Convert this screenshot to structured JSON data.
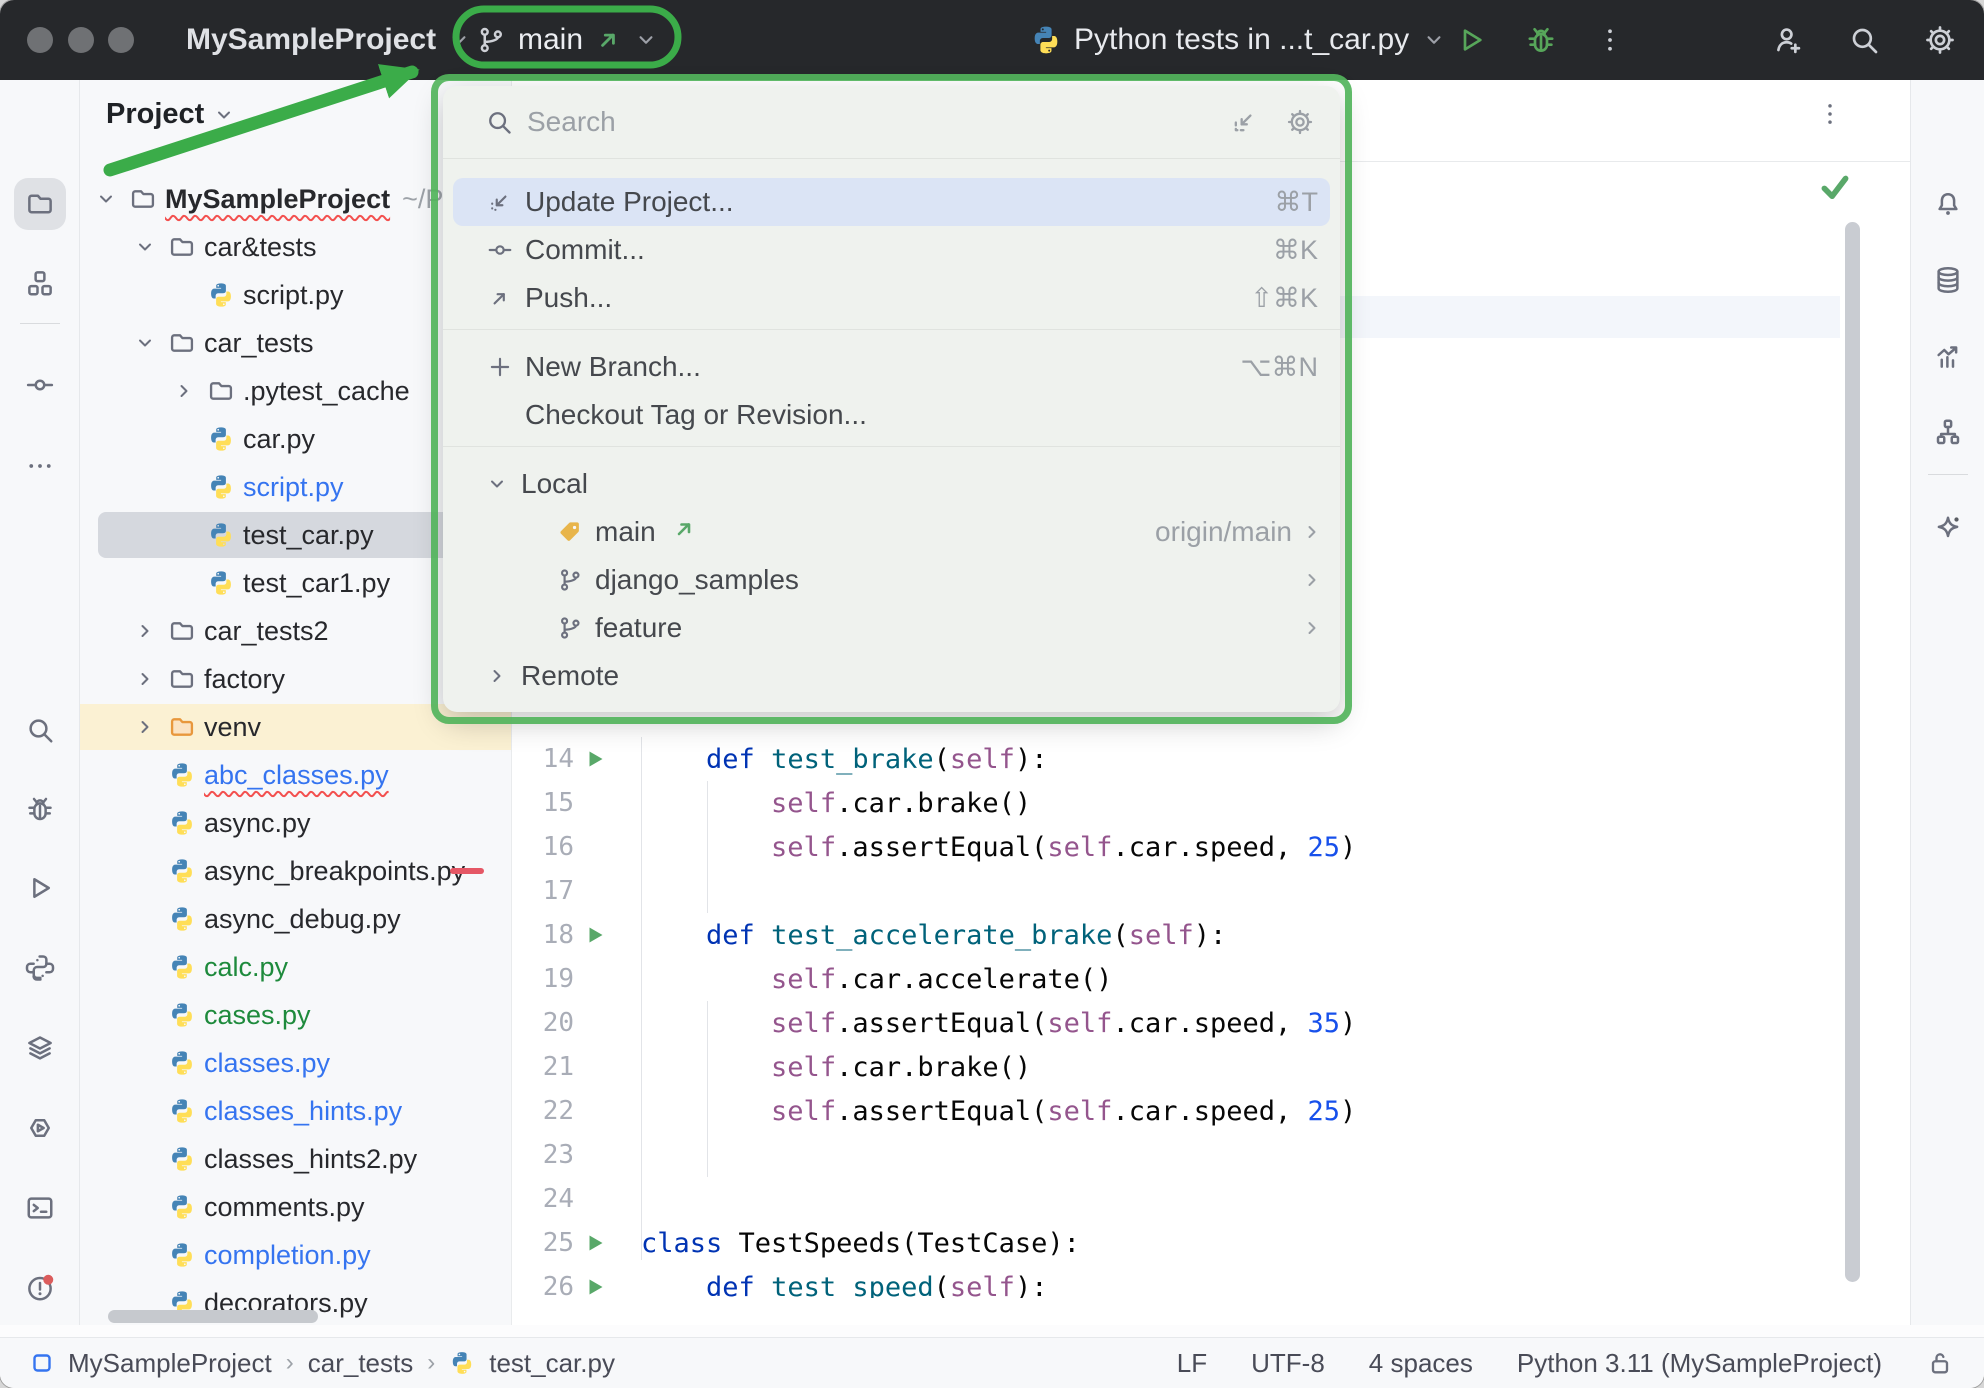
{
  "titlebar": {
    "project_name": "MySampleProject",
    "branch_name": "main",
    "run_config": "Python tests in ...t_car.py"
  },
  "left_toolbar": {
    "icons": [
      "folder",
      "structure",
      "commit",
      "more",
      "search",
      "bug",
      "play",
      "python-mono",
      "layers",
      "services",
      "terminal",
      "problems",
      "git-branch"
    ]
  },
  "right_toolbar": {
    "icons": [
      "bell",
      "database",
      "chart",
      "hierarchy",
      "sparkle"
    ]
  },
  "project_panel": {
    "header": "Project",
    "rows": [
      {
        "depth": 0,
        "chev": "open",
        "icon": "folder",
        "label": "MySampleProject",
        "bold": true,
        "squiggle": true,
        "suffix": "~/P"
      },
      {
        "depth": 1,
        "chev": "open",
        "icon": "folder",
        "label": "car&tests"
      },
      {
        "depth": 2,
        "chev": "none",
        "icon": "python",
        "label": "script.py"
      },
      {
        "depth": 1,
        "chev": "open",
        "icon": "folder",
        "label": "car_tests"
      },
      {
        "depth": 2,
        "chev": "closed",
        "icon": "folder",
        "label": ".pytest_cache"
      },
      {
        "depth": 2,
        "chev": "none",
        "icon": "python",
        "label": "car.py"
      },
      {
        "depth": 2,
        "chev": "none",
        "icon": "python",
        "label": "script.py",
        "color": "blue"
      },
      {
        "depth": 2,
        "chev": "none",
        "icon": "python",
        "label": "test_car.py",
        "selected": true
      },
      {
        "depth": 2,
        "chev": "none",
        "icon": "python",
        "label": "test_car1.py"
      },
      {
        "depth": 1,
        "chev": "closed",
        "icon": "folder",
        "label": "car_tests2"
      },
      {
        "depth": 1,
        "chev": "closed",
        "icon": "folder",
        "label": "factory"
      },
      {
        "depth": 1,
        "chev": "closed",
        "icon": "folder-venv",
        "label": "venv",
        "rowbg": "#FBF1D3"
      },
      {
        "depth": 1,
        "chev": "none",
        "icon": "python",
        "label": "abc_classes.py",
        "color": "blue",
        "squiggle": true
      },
      {
        "depth": 1,
        "chev": "none",
        "icon": "python",
        "label": "async.py"
      },
      {
        "depth": 1,
        "chev": "none",
        "icon": "python",
        "label": "async_breakpoints.py",
        "reddash": true
      },
      {
        "depth": 1,
        "chev": "none",
        "icon": "python",
        "label": "async_debug.py"
      },
      {
        "depth": 1,
        "chev": "none",
        "icon": "python",
        "label": "calc.py",
        "color": "green"
      },
      {
        "depth": 1,
        "chev": "none",
        "icon": "python",
        "label": "cases.py",
        "color": "green"
      },
      {
        "depth": 1,
        "chev": "none",
        "icon": "python",
        "label": "classes.py",
        "color": "blue"
      },
      {
        "depth": 1,
        "chev": "none",
        "icon": "python",
        "label": "classes_hints.py",
        "color": "blue"
      },
      {
        "depth": 1,
        "chev": "none",
        "icon": "python",
        "label": "classes_hints2.py"
      },
      {
        "depth": 1,
        "chev": "none",
        "icon": "python",
        "label": "comments.py"
      },
      {
        "depth": 1,
        "chev": "none",
        "icon": "python",
        "label": "completion.py",
        "color": "blue"
      },
      {
        "depth": 1,
        "chev": "none",
        "icon": "python",
        "label": "decorators.py"
      }
    ]
  },
  "branch_popup": {
    "search_placeholder": "Search",
    "actions": [
      {
        "icon": "arrow-dl",
        "label": "Update Project...",
        "shortcut": "⌘T",
        "selected": true
      },
      {
        "icon": "commit",
        "label": "Commit...",
        "shortcut": "⌘K"
      },
      {
        "icon": "arrow-ur",
        "label": "Push...",
        "shortcut": "⇧⌘K"
      }
    ],
    "actions2": [
      {
        "icon": "plus",
        "label": "New Branch...",
        "shortcut": "⌥⌘N"
      },
      {
        "icon": "none",
        "label": "Checkout Tag or Revision...",
        "shortcut": ""
      }
    ],
    "local_header": "Local",
    "remote_header": "Remote",
    "local_branches": [
      {
        "icon": "tag",
        "label": "main",
        "current": true,
        "tracking": "origin/main"
      },
      {
        "icon": "git-branch",
        "label": "django_samples"
      },
      {
        "icon": "git-branch",
        "label": "feature"
      }
    ]
  },
  "editor": {
    "lines": [
      {
        "n": "14",
        "run": true,
        "tokens": [
          [
            "p",
            "    "
          ],
          [
            "k",
            "def"
          ],
          [
            "p",
            " "
          ],
          [
            "f",
            "test_brake"
          ],
          [
            "p",
            "("
          ],
          [
            "s",
            "self"
          ],
          [
            "p",
            "):"
          ]
        ]
      },
      {
        "n": "15",
        "tokens": [
          [
            "p",
            "        "
          ],
          [
            "s",
            "self"
          ],
          [
            "p",
            ".car.brake()"
          ]
        ]
      },
      {
        "n": "16",
        "tokens": [
          [
            "p",
            "        "
          ],
          [
            "s",
            "self"
          ],
          [
            "p",
            ".assertEqual("
          ],
          [
            "s",
            "self"
          ],
          [
            "p",
            ".car.speed, "
          ],
          [
            "n",
            "25"
          ],
          [
            "p",
            ")"
          ]
        ]
      },
      {
        "n": "17",
        "tokens": []
      },
      {
        "n": "18",
        "run": true,
        "tokens": [
          [
            "p",
            "    "
          ],
          [
            "k",
            "def"
          ],
          [
            "p",
            " "
          ],
          [
            "f",
            "test_accelerate_brake"
          ],
          [
            "p",
            "("
          ],
          [
            "s",
            "self"
          ],
          [
            "p",
            "):"
          ]
        ]
      },
      {
        "n": "19",
        "tokens": [
          [
            "p",
            "        "
          ],
          [
            "s",
            "self"
          ],
          [
            "p",
            ".car.accelerate()"
          ]
        ]
      },
      {
        "n": "20",
        "tokens": [
          [
            "p",
            "        "
          ],
          [
            "s",
            "self"
          ],
          [
            "p",
            ".assertEqual("
          ],
          [
            "s",
            "self"
          ],
          [
            "p",
            ".car.speed, "
          ],
          [
            "n",
            "35"
          ],
          [
            "p",
            ")"
          ]
        ]
      },
      {
        "n": "21",
        "tokens": [
          [
            "p",
            "        "
          ],
          [
            "s",
            "self"
          ],
          [
            "p",
            ".car.brake()"
          ]
        ]
      },
      {
        "n": "22",
        "tokens": [
          [
            "p",
            "        "
          ],
          [
            "s",
            "self"
          ],
          [
            "p",
            ".assertEqual("
          ],
          [
            "s",
            "self"
          ],
          [
            "p",
            ".car.speed, "
          ],
          [
            "n",
            "25"
          ],
          [
            "p",
            ")"
          ]
        ]
      },
      {
        "n": "23",
        "tokens": []
      },
      {
        "n": "24",
        "tokens": []
      },
      {
        "n": "25",
        "run": true,
        "tokens": [
          [
            "k",
            "class"
          ],
          [
            "p",
            " "
          ],
          [
            "p",
            "TestSpeeds"
          ],
          [
            "p",
            "(TestCase):"
          ]
        ]
      },
      {
        "n": "26",
        "run": true,
        "tokens": [
          [
            "p",
            "    "
          ],
          [
            "k",
            "def"
          ],
          [
            "p",
            " "
          ],
          [
            "f",
            "test_speed"
          ],
          [
            "p",
            "("
          ],
          [
            "s",
            "self"
          ],
          [
            "p",
            "):"
          ]
        ]
      }
    ]
  },
  "statusbar": {
    "breadcrumbs": [
      "MySampleProject",
      "car_tests",
      "test_car.py"
    ],
    "items": [
      "LF",
      "UTF-8",
      "4 spaces",
      "Python 3.11 (MySampleProject)"
    ]
  },
  "colors": {
    "annotation_green": "#3BAC49",
    "accent_blue": "#3574F0",
    "vcs_green": "#1E8A3C",
    "run_green": "#59A869",
    "selection_blue": "#DBE4F5",
    "tag_amber": "#E8B54A"
  }
}
